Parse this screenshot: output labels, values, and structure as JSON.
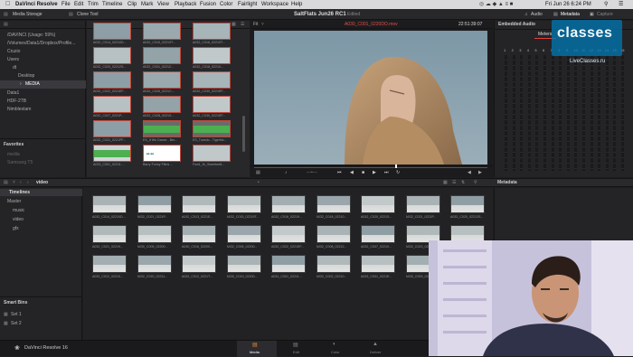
{
  "menubar": {
    "app": "DaVinci Resolve",
    "items": [
      "File",
      "Edit",
      "Trim",
      "Timeline",
      "Clip",
      "Mark",
      "View",
      "Playback",
      "Fusion",
      "Color",
      "Fairlight",
      "Workspace",
      "Help"
    ],
    "clock": "Fri Jun 26  6:24 PM"
  },
  "toolbar": {
    "media_storage": "Media Storage",
    "clone_tool": "Clone Tool",
    "project": "SaltFlats Jun26 RC1",
    "edited": "Edited",
    "audio": "Audio",
    "metadata": "Metadata",
    "capture": "Capture"
  },
  "storage": {
    "items": [
      "/DAVINCI (Usage: 59%)",
      "/Volumes/Data1/Dropbox/Profile...",
      "Cruzio",
      "Users",
      "dt",
      "Desktop",
      "MEDIA",
      "Data1",
      "HDF-2TB",
      "Nimblestam"
    ],
    "favorites_title": "Favorites",
    "favorites": [
      "media",
      "Samsung T5"
    ]
  },
  "viewer": {
    "fit": "Fit",
    "clip": "A030_C001_0220DO.mov",
    "timecode": "22:51:39:07"
  },
  "audio": {
    "title": "Embedded Audio",
    "tab_meters": "Meters",
    "channels": [
      "1",
      "2",
      "3",
      "4",
      "5",
      "6",
      "7",
      "8",
      "9",
      "10",
      "11",
      "12",
      "13",
      "14",
      "15",
      "16"
    ]
  },
  "media_pool": {
    "bin_name": "video",
    "timelines": "Timelines",
    "master": "Master",
    "bins": [
      "music",
      "video",
      "gfx"
    ],
    "smart_bins_title": "Smart Bins",
    "smart_bins": [
      "Set 1",
      "Set 2"
    ],
    "metadata_title": "Metadata"
  },
  "storage_thumbs": [
    "A032_C014_02210D...",
    "A032_C015_02219T...",
    "A032_C016_02219T...",
    "A032_C020_02212S...",
    "A032_C031_02212...",
    "A032_C018_02210...",
    "A032_C022_0221EF...",
    "A032_C026_0221C...",
    "A032_C030_0221EF...",
    "A032_C027_0221P...",
    "A032_C028_0221S...",
    "A032_C030_0221EF...",
    "A032_C031_0221PF...",
    "ES_If We Dance - Ber...",
    "ES_Tuxedo - Tigerblo...",
    "A033_C001_02211...",
    "Barry Funny Films ...",
    "Fund_Jn_Sweetwell..."
  ],
  "pool_thumbs": [
    "A032_C014_02210D...",
    "A032_C021_0221P...",
    "A032_C013_0221E...",
    "A032_C015_02219T...",
    "A032_C016_02219...",
    "A032_C018_02210...",
    "A032_C020_0221S...",
    "A032_C021_0221P...",
    "A032_C020_02212S...",
    "A032_C021_02219...",
    "A030_C005_02200...",
    "A030_C016_02200...",
    "A032_C006_02200...",
    "A032_C022_0221EF...",
    "A032_C008_02212...",
    "A032_C007_02210...",
    "A032_C023_02215...",
    "A032_C013_02212...",
    "A032_C012_02210...",
    "A032_C020_02211...",
    "A032_C012_0221T...",
    "A030_C019_02200...",
    "A031_C001_02211...",
    "A032_C002_02210...",
    "A033_C001_0221E...",
    "A030_C009_02200..."
  ],
  "pages": [
    "Media",
    "Edit",
    "Color",
    "Deliver"
  ],
  "footer_app": "DaVinci Resolve 16",
  "watermark": {
    "name": "classes",
    "url": "LiveClasses.ru"
  }
}
